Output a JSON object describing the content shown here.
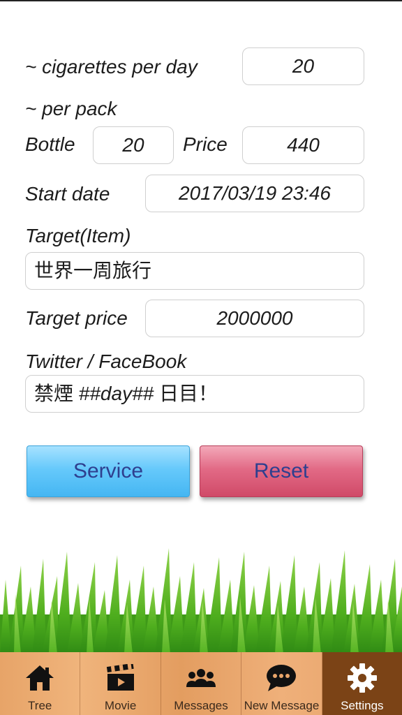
{
  "labels": {
    "cigarettes_per_day": "~ cigarettes per day",
    "per_pack": "~ per pack",
    "bottle": "Bottle",
    "price": "Price",
    "start_date": "Start date",
    "target_item": "Target(Item)",
    "target_price": "Target price",
    "social": "Twitter / FaceBook"
  },
  "values": {
    "cigarettes_per_day": "20",
    "bottle": "20",
    "price": "440",
    "start_date": "2017/03/19 23:46",
    "target_item": "世界一周旅行",
    "target_price": "2000000",
    "social_prefix": "禁煙 ",
    "social_token": "##day##",
    "social_suffix": " 日目！"
  },
  "buttons": {
    "service": "Service",
    "reset": "Reset"
  },
  "tabs": [
    {
      "label": "Tree",
      "icon": "home-icon"
    },
    {
      "label": "Movie",
      "icon": "clapperboard-icon"
    },
    {
      "label": "Messages",
      "icon": "people-icon"
    },
    {
      "label": "New Message",
      "icon": "chat-bubble-icon"
    },
    {
      "label": "Settings",
      "icon": "gear-icon",
      "active": true
    }
  ],
  "colors": {
    "service_button": "#66c9fb",
    "reset_button": "#e26a86",
    "tabbar_wood": "#e9a56a",
    "active_tab": "#7b4316",
    "grass": "#4fae1e"
  }
}
